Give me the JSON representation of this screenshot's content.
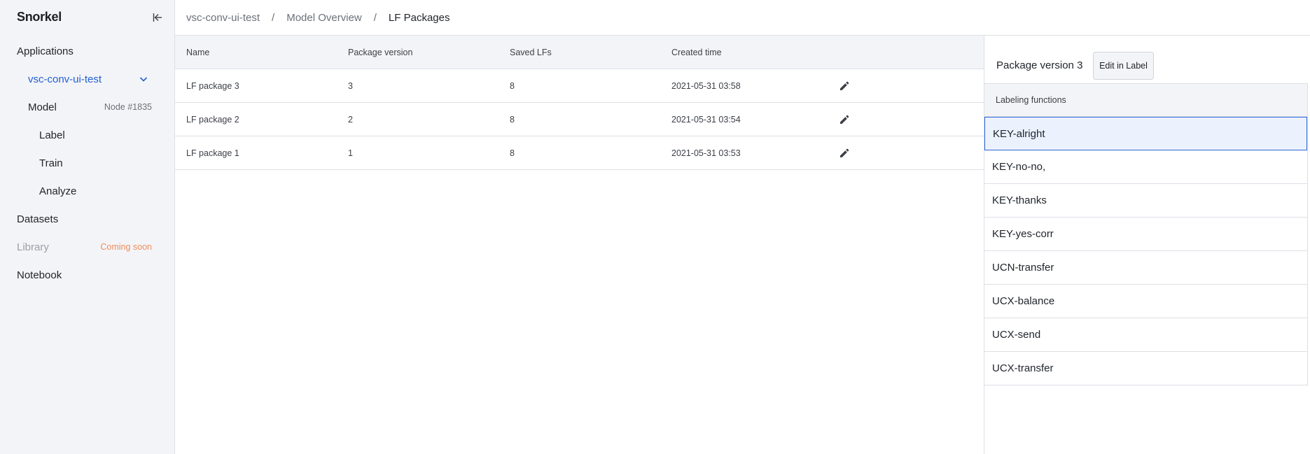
{
  "app": {
    "logo": "Snorkel"
  },
  "sidebar": {
    "items": [
      {
        "label": "Applications"
      },
      {
        "label": "vsc-conv-ui-test"
      },
      {
        "label": "Model",
        "meta": "Node #1835"
      },
      {
        "label": "Label"
      },
      {
        "label": "Train"
      },
      {
        "label": "Analyze"
      },
      {
        "label": "Datasets"
      },
      {
        "label": "Library",
        "meta": "Coming soon"
      },
      {
        "label": "Notebook"
      }
    ]
  },
  "breadcrumb": {
    "items": [
      "vsc-conv-ui-test",
      "Model Overview",
      "LF Packages"
    ],
    "separator": "/"
  },
  "table": {
    "columns": [
      "Name",
      "Package version",
      "Saved LFs",
      "Created time"
    ],
    "rows": [
      {
        "name": "LF package 3",
        "version": "3",
        "saved": "8",
        "created": "2021-05-31 03:58"
      },
      {
        "name": "LF package 2",
        "version": "2",
        "saved": "8",
        "created": "2021-05-31 03:54"
      },
      {
        "name": "LF package 1",
        "version": "1",
        "saved": "8",
        "created": "2021-05-31 03:53"
      }
    ]
  },
  "panel": {
    "title": "Package version 3",
    "edit_button": "Edit in Label",
    "lf_header": "Labeling functions",
    "lfs": [
      "KEY-alright",
      "KEY-no-no,",
      "KEY-thanks",
      "KEY-yes-corr",
      "UCN-transfer",
      "UCX-balance",
      "UCX-send",
      "UCX-transfer"
    ]
  },
  "icons": {
    "collapse": "collapse-sidebar-icon",
    "expand": "chevron-down-icon",
    "edit": "pencil-icon"
  },
  "colors": {
    "accent": "#1f5fd6",
    "coming_soon": "#ee8f5c",
    "sidebar_bg": "#f3f4f7",
    "selected_row_bg": "#ecf2fd",
    "selected_row_border": "#2b67d9"
  }
}
